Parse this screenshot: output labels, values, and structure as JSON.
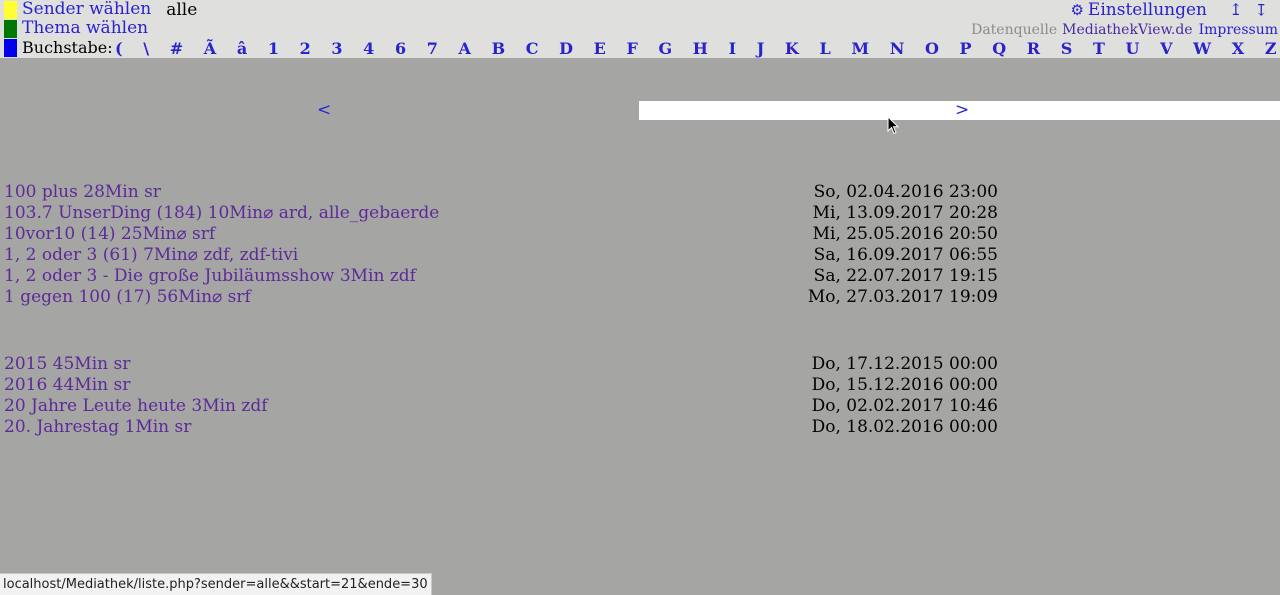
{
  "header": {
    "sender_label": "Sender wählen",
    "sender_value": "alle",
    "thema_label": "Thema wählen",
    "buchstabe_label": "Buchstabe:",
    "letters": [
      "(",
      "\\",
      "#",
      "Ã",
      "â",
      "1",
      "2",
      "3",
      "4",
      "6",
      "7",
      "A",
      "B",
      "C",
      "D",
      "E",
      "F",
      "G",
      "H",
      "I",
      "J",
      "K",
      "L",
      "M",
      "N",
      "O",
      "P",
      "Q",
      "R",
      "S",
      "T",
      "U",
      "V",
      "W",
      "X",
      "Z"
    ],
    "settings_icon": "⚙",
    "settings_label": "Einstellungen",
    "arrow_up": "↥",
    "arrow_down": "↥",
    "source_label": "Datenquelle",
    "source_link": "MediathekView.de",
    "impressum": "Impressum",
    "colors": {
      "sender": "#ffff33",
      "thema": "#007700",
      "buchstabe": "#0000ee"
    }
  },
  "nav": {
    "prev": "<",
    "next": ">"
  },
  "groups": [
    {
      "rows": [
        {
          "title": "100 plus   28Min sr",
          "date": "So, 02.04.2016 23:00"
        },
        {
          "title": "103.7 UnserDing (184)   10Min⌀ ard, alle_gebaerde",
          "date": "Mi, 13.09.2017 20:28"
        },
        {
          "title": "10vor10 (14)   25Min⌀ srf",
          "date": "Mi, 25.05.2016 20:50"
        },
        {
          "title": "1, 2 oder 3 (61)   7Min⌀ zdf, zdf-tivi",
          "date": "Sa, 16.09.2017 06:55"
        },
        {
          "title": "1, 2 oder 3 - Die große Jubiläumsshow   3Min zdf",
          "date": "Sa, 22.07.2017 19:15"
        },
        {
          "title": "1 gegen 100 (17)   56Min⌀ srf",
          "date": "Mo, 27.03.2017 19:09"
        }
      ]
    },
    {
      "rows": [
        {
          "title": "2015   45Min sr",
          "date": "Do, 17.12.2015 00:00"
        },
        {
          "title": "2016   44Min sr",
          "date": "Do, 15.12.2016 00:00"
        },
        {
          "title": "20 Jahre Leute heute   3Min zdf",
          "date": "Do, 02.02.2017 10:46"
        },
        {
          "title": "20. Jahrestag   1Min sr",
          "date": "Do, 18.02.2016 00:00"
        }
      ]
    }
  ],
  "status_url": "localhost/Mediathek/liste.php?sender=alle&&start=21&ende=30"
}
